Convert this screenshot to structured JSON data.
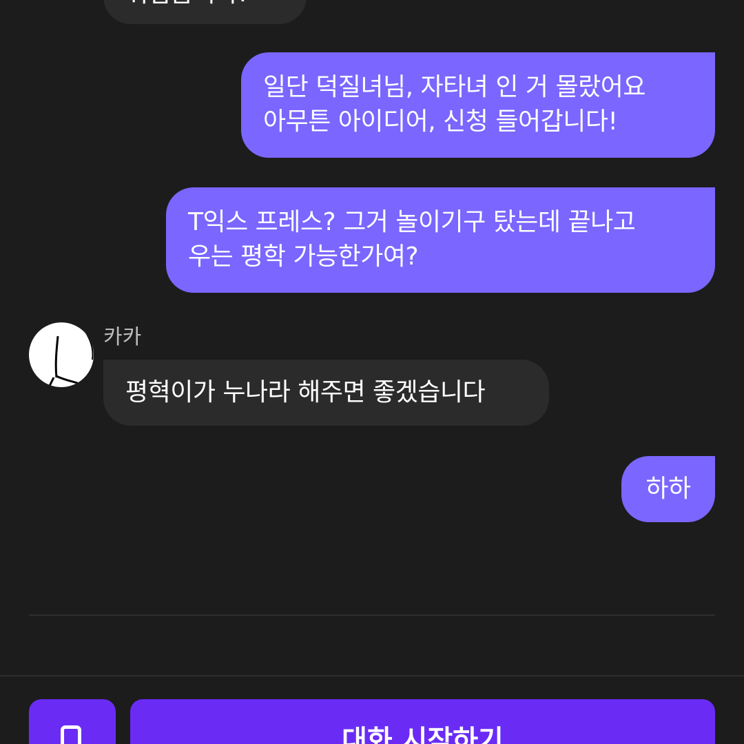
{
  "messages": [
    {
      "direction": "incoming",
      "text": "귀엽습니다!"
    },
    {
      "direction": "outgoing",
      "text": "일단 덕질녀님, 자타녀 인 거 몰랐어요\n아무튼 아이디어, 신청 들어갑니다!"
    },
    {
      "direction": "outgoing",
      "text": "T익스 프레스? 그거 놀이기구 탔는데 끝나고\n우는 평학 가능한가여?"
    },
    {
      "direction": "incoming",
      "text": "평혁이가 누나라 해주면 좋겠습니다"
    },
    {
      "direction": "outgoing",
      "text": "하하"
    }
  ],
  "sender": {
    "name": "카카",
    "avatar_icon": "sketch-avatar-icon"
  },
  "bottom_bar": {
    "call_icon": "phone-icon",
    "start_label": "대화 시작하기"
  },
  "colors": {
    "background": "#1c1c1c",
    "outgoing_bubble": "#7b66ff",
    "incoming_bubble": "#2b2b2b",
    "primary_button": "#6a2cf5"
  }
}
